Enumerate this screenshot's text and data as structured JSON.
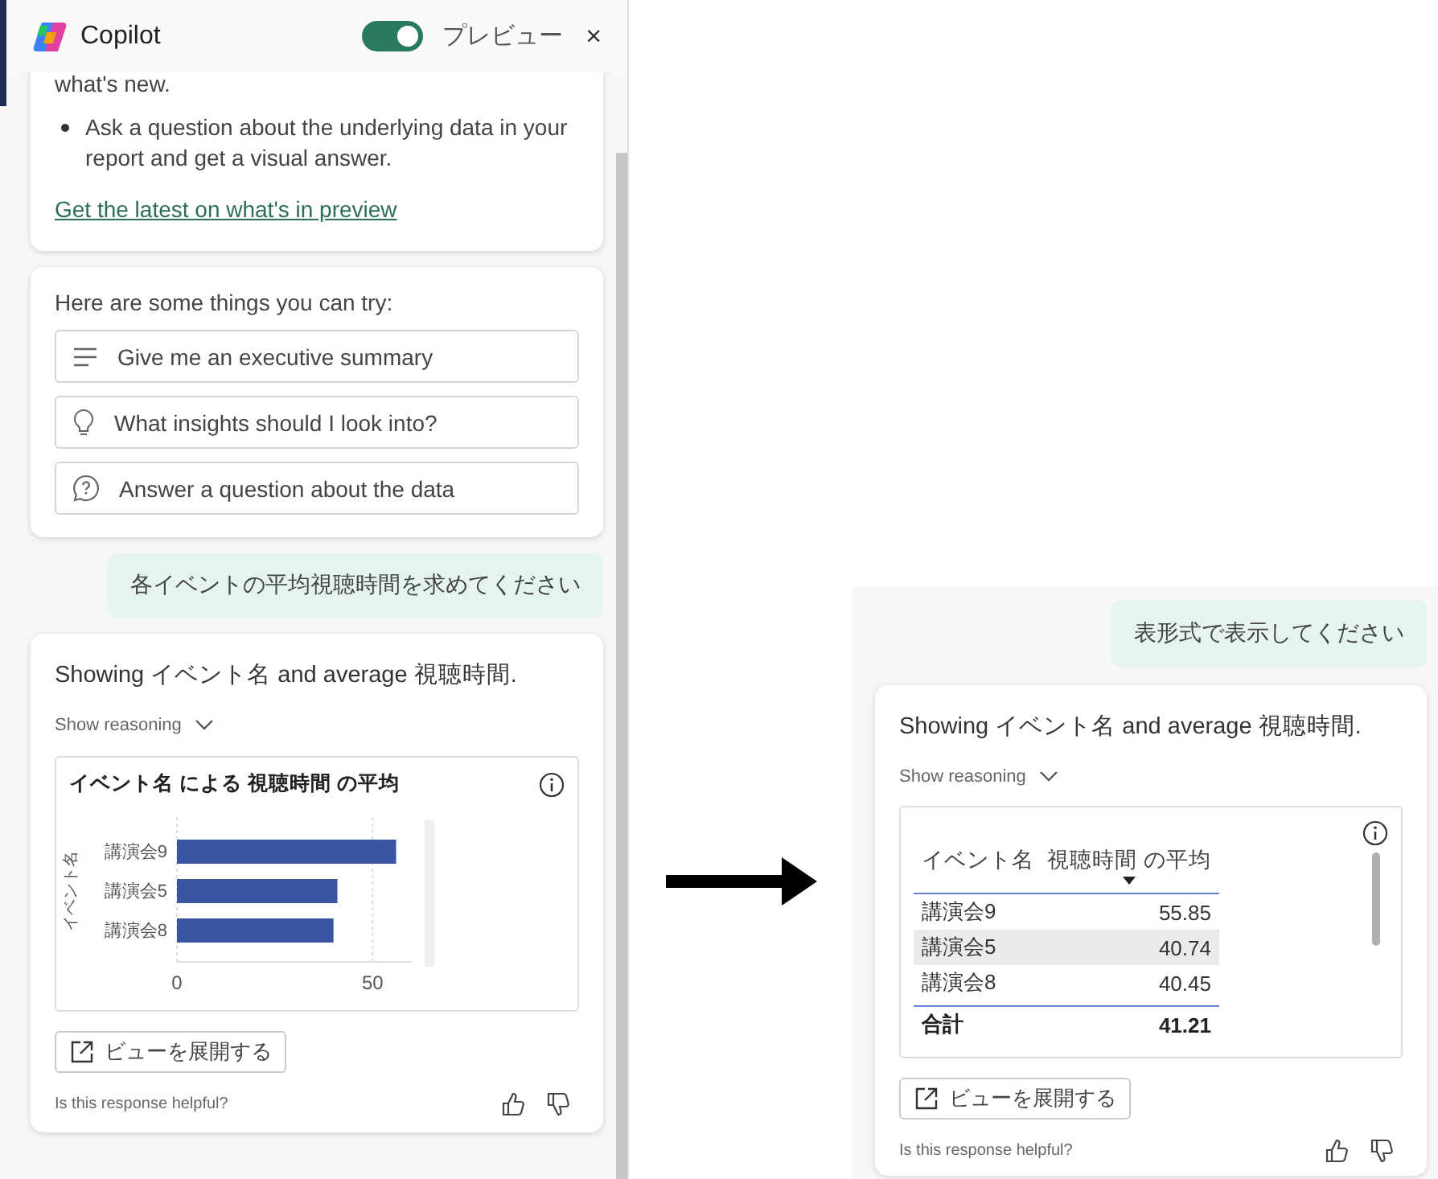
{
  "left_panel": {
    "header": {
      "title": "Copilot",
      "preview_toggle": {
        "on": true,
        "label": "プレビュー"
      },
      "close": "×"
    },
    "whats_new": {
      "cut_text": "what's new.",
      "bullets": [
        "Ask a question about the underlying data in your report and get a visual answer."
      ],
      "link": "Get the latest on what's in preview"
    },
    "suggestions": {
      "heading": "Here are some things you can try:",
      "items": [
        {
          "kind": "summary",
          "label": "Give me an executive summary"
        },
        {
          "kind": "insight",
          "label": "What insights should I look into?"
        },
        {
          "kind": "question",
          "label": "Answer a question about the data"
        }
      ]
    },
    "user_message": "各イベントの平均視聴時間を求めてください",
    "response": {
      "text": "Showing イベント名 and average 視聴時間.",
      "reasoning": {
        "label": "Show reasoning",
        "expanded": false
      },
      "visual": {
        "kind": "chart",
        "chart_data": {
          "type": "bar",
          "orientation": "horizontal",
          "title": "イベント名 による 視聴時間 の平均",
          "ylabel": "イベント名",
          "categories": [
            "講演会9",
            "講演会5",
            "講演会8"
          ],
          "series": [
            {
              "color": "#3a56a3",
              "values": [
                56,
                41,
                40
              ]
            }
          ],
          "xlim": [
            0,
            60
          ],
          "xticks": [
            0,
            50
          ]
        }
      },
      "expand_button": "ビューを展開する",
      "feedback": "Is this response helpful?"
    }
  },
  "right_panel": {
    "user_message": "表形式で表示してください",
    "response": {
      "text": "Showing イベント名 and average 視聴時間.",
      "reasoning": {
        "label": "Show reasoning",
        "expanded": false
      },
      "visual": {
        "kind": "table",
        "columns": [
          {
            "label": "イベント名",
            "sorted": false
          },
          {
            "label": "視聴時間 の平均",
            "sorted": true
          }
        ],
        "rows": [
          {
            "cells": [
              "講演会9",
              "55.85"
            ],
            "selected": false
          },
          {
            "cells": [
              "講演会5",
              "40.74"
            ],
            "selected": true
          },
          {
            "cells": [
              "講演会8",
              "40.45"
            ],
            "selected": false
          }
        ],
        "total": {
          "label": "合計",
          "value": "41.21"
        }
      },
      "expand_button": "ビューを展開する",
      "feedback": "Is this response helpful?"
    }
  }
}
